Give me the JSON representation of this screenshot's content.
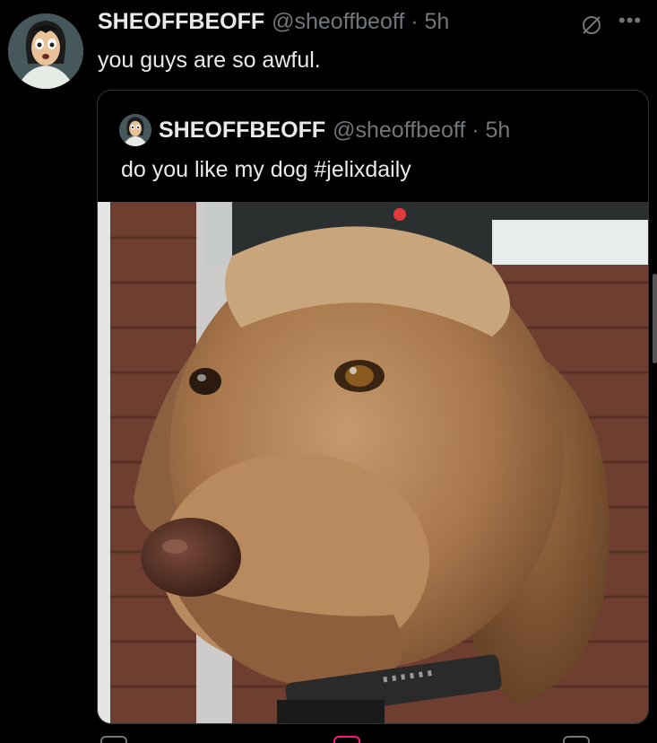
{
  "tweet": {
    "display_name": "SHEOFFBEOFF",
    "handle_time": "@sheoffbeoff · 5h",
    "text": "you guys are so awful."
  },
  "quoted": {
    "display_name": "SHEOFFBEOFF",
    "handle_time": "@sheoffbeoff · 5h",
    "text_plain": "do you like my dog ",
    "hashtag": "#jelixdaily"
  },
  "icons": {
    "grok": "grok-icon",
    "more": "more-icon"
  },
  "colors": {
    "background": "#000000",
    "text": "#e7e9ea",
    "muted": "#71767b",
    "border": "#2f3336"
  }
}
